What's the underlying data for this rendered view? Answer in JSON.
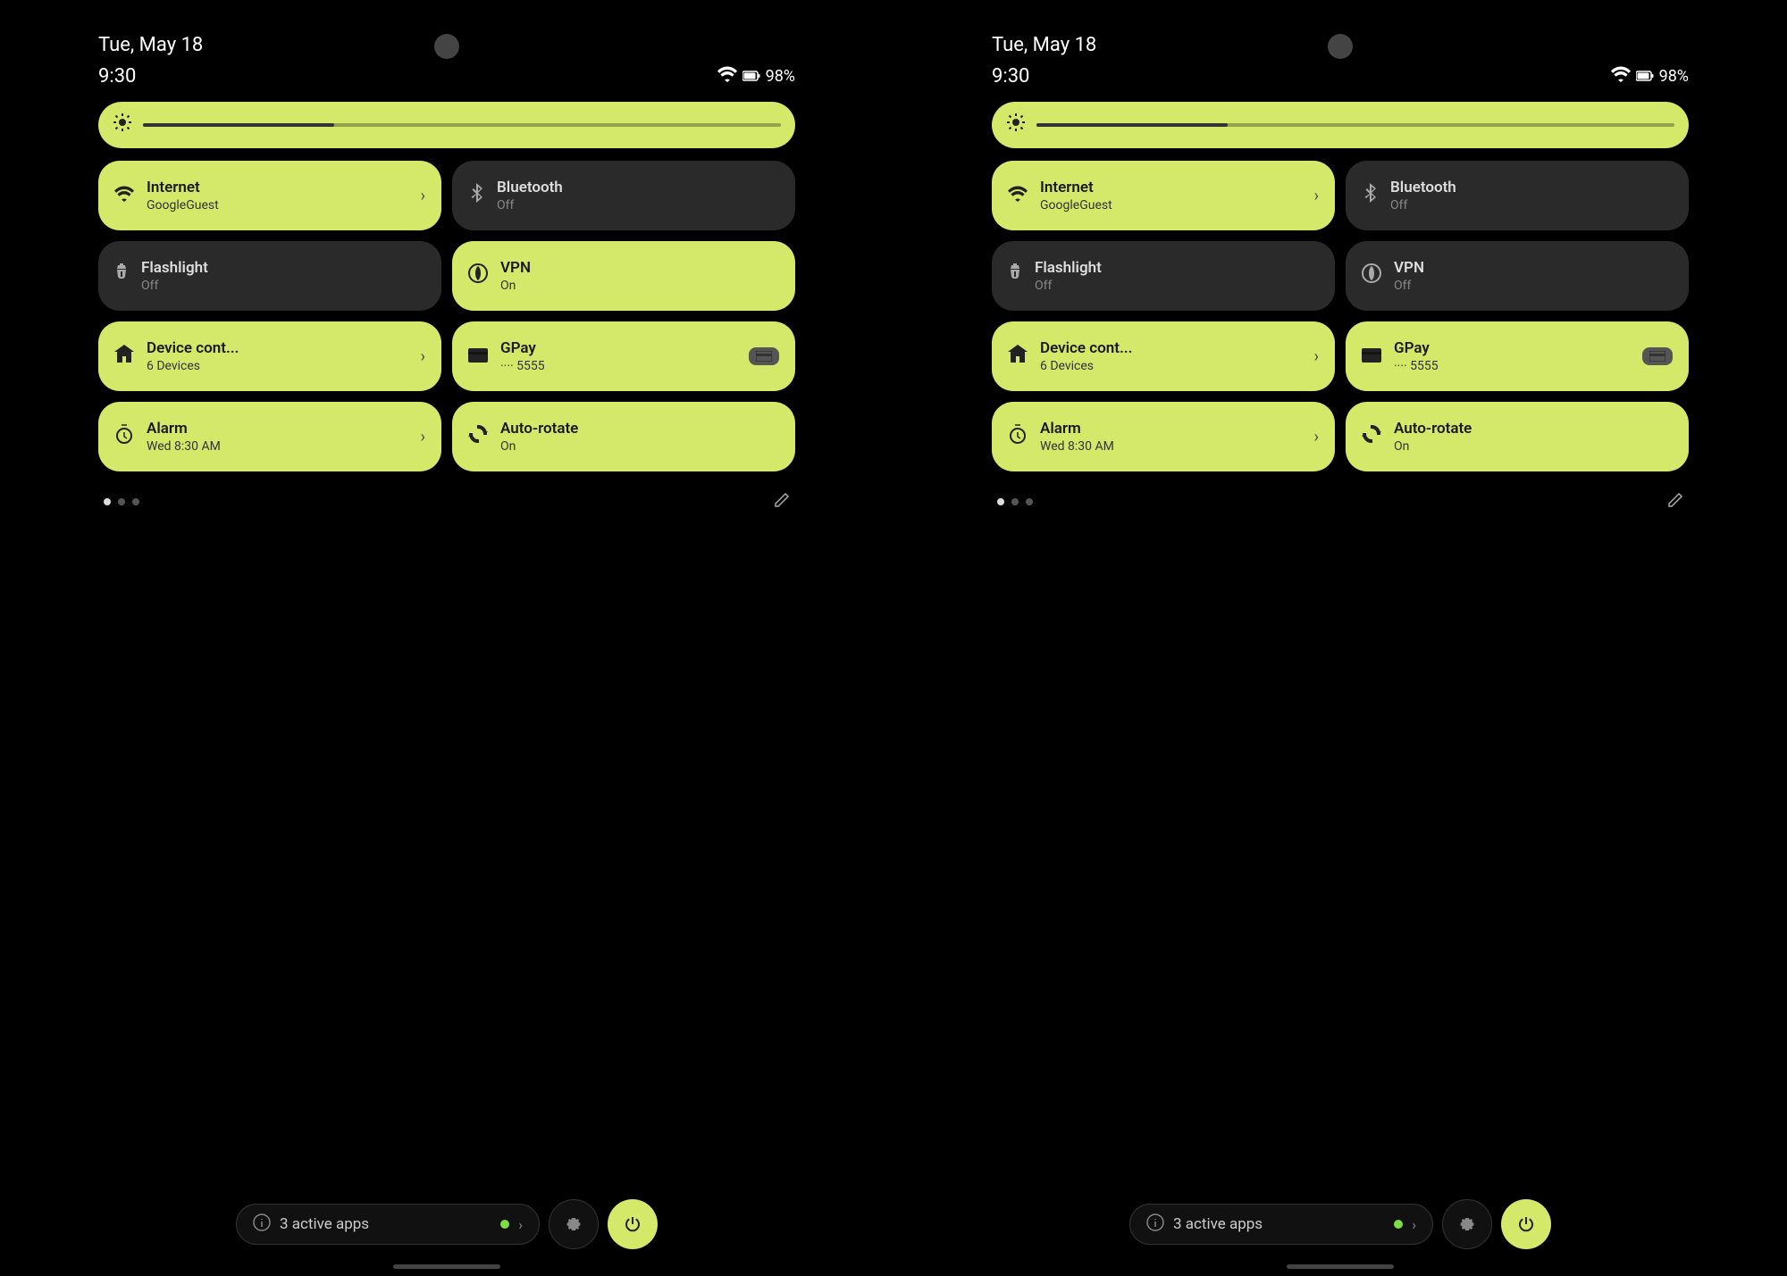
{
  "panels": [
    {
      "id": "panel-left",
      "statusBar": {
        "date": "Tue, May 18",
        "time": "9:30",
        "battery": "98%",
        "wifiIcon": "wifi",
        "batteryIconAlt": "battery"
      },
      "brightness": {
        "iconLabel": "brightness",
        "fillPercent": 30
      },
      "tiles": [
        {
          "id": "internet",
          "active": true,
          "icon": "wifi",
          "title": "Internet",
          "subtitle": "GoogleGuest",
          "hasArrow": true,
          "hasCard": false
        },
        {
          "id": "bluetooth",
          "active": false,
          "icon": "bluetooth",
          "title": "Bluetooth",
          "subtitle": "Off",
          "hasArrow": false,
          "hasCard": false
        },
        {
          "id": "flashlight",
          "active": false,
          "icon": "flashlight",
          "title": "Flashlight",
          "subtitle": "Off",
          "hasArrow": false,
          "hasCard": false
        },
        {
          "id": "vpn",
          "active": true,
          "icon": "vpn",
          "title": "VPN",
          "subtitle": "On",
          "hasArrow": false,
          "hasCard": false
        },
        {
          "id": "device-control",
          "active": true,
          "icon": "home",
          "title": "Device cont...",
          "subtitle": "6 Devices",
          "hasArrow": true,
          "hasCard": false
        },
        {
          "id": "gpay",
          "active": true,
          "icon": "card",
          "title": "GPay",
          "subtitle": "···· 5555",
          "hasArrow": false,
          "hasCard": true,
          "cardText": "···· 5555"
        },
        {
          "id": "alarm",
          "active": true,
          "icon": "alarm",
          "title": "Alarm",
          "subtitle": "Wed 8:30 AM",
          "hasArrow": true,
          "hasCard": false
        },
        {
          "id": "autorotate",
          "active": true,
          "icon": "rotate",
          "title": "Auto-rotate",
          "subtitle": "On",
          "hasArrow": false,
          "hasCard": false
        }
      ],
      "dots": [
        true,
        false,
        false
      ],
      "bottomBar": {
        "activeAppsCount": "3",
        "activeAppsLabel": "active apps",
        "settingsLabel": "settings",
        "powerLabel": "power"
      }
    },
    {
      "id": "panel-right",
      "statusBar": {
        "date": "Tue, May 18",
        "time": "9:30",
        "battery": "98%",
        "wifiIcon": "wifi",
        "batteryIconAlt": "battery"
      },
      "brightness": {
        "iconLabel": "brightness",
        "fillPercent": 30
      },
      "tiles": [
        {
          "id": "internet",
          "active": true,
          "icon": "wifi",
          "title": "Internet",
          "subtitle": "GoogleGuest",
          "hasArrow": true,
          "hasCard": false
        },
        {
          "id": "bluetooth",
          "active": false,
          "icon": "bluetooth",
          "title": "Bluetooth",
          "subtitle": "Off",
          "hasArrow": false,
          "hasCard": false
        },
        {
          "id": "flashlight",
          "active": false,
          "icon": "flashlight",
          "title": "Flashlight",
          "subtitle": "Off",
          "hasArrow": false,
          "hasCard": false
        },
        {
          "id": "vpn",
          "active": false,
          "icon": "vpn",
          "title": "VPN",
          "subtitle": "Off",
          "hasArrow": false,
          "hasCard": false
        },
        {
          "id": "device-control",
          "active": true,
          "icon": "home",
          "title": "Device cont...",
          "subtitle": "6 Devices",
          "hasArrow": true,
          "hasCard": false
        },
        {
          "id": "gpay",
          "active": true,
          "icon": "card",
          "title": "GPay",
          "subtitle": "···· 5555",
          "hasArrow": false,
          "hasCard": true,
          "cardText": "···· 5555"
        },
        {
          "id": "alarm",
          "active": true,
          "icon": "alarm",
          "title": "Alarm",
          "subtitle": "Wed 8:30 AM",
          "hasArrow": true,
          "hasCard": false
        },
        {
          "id": "autorotate",
          "active": true,
          "icon": "rotate",
          "title": "Auto-rotate",
          "subtitle": "On",
          "hasArrow": false,
          "hasCard": false
        }
      ],
      "dots": [
        true,
        false,
        false
      ],
      "bottomBar": {
        "activeAppsCount": "3",
        "activeAppsLabel": "active apps",
        "settingsLabel": "settings",
        "powerLabel": "power"
      }
    }
  ],
  "colors": {
    "activeYellow": "#d4e86a",
    "inactiveDark": "#2a2a2a",
    "background": "#000000"
  },
  "icons": {
    "wifi": "▾",
    "bluetooth": "✦",
    "flashlight": "▯",
    "vpn": "⊕",
    "home": "⌂",
    "card": "▬",
    "alarm": "◷",
    "rotate": "↻",
    "brightness": "✺",
    "edit": "✏",
    "info": "ⓘ",
    "settings": "⚙",
    "power": "⏻"
  }
}
